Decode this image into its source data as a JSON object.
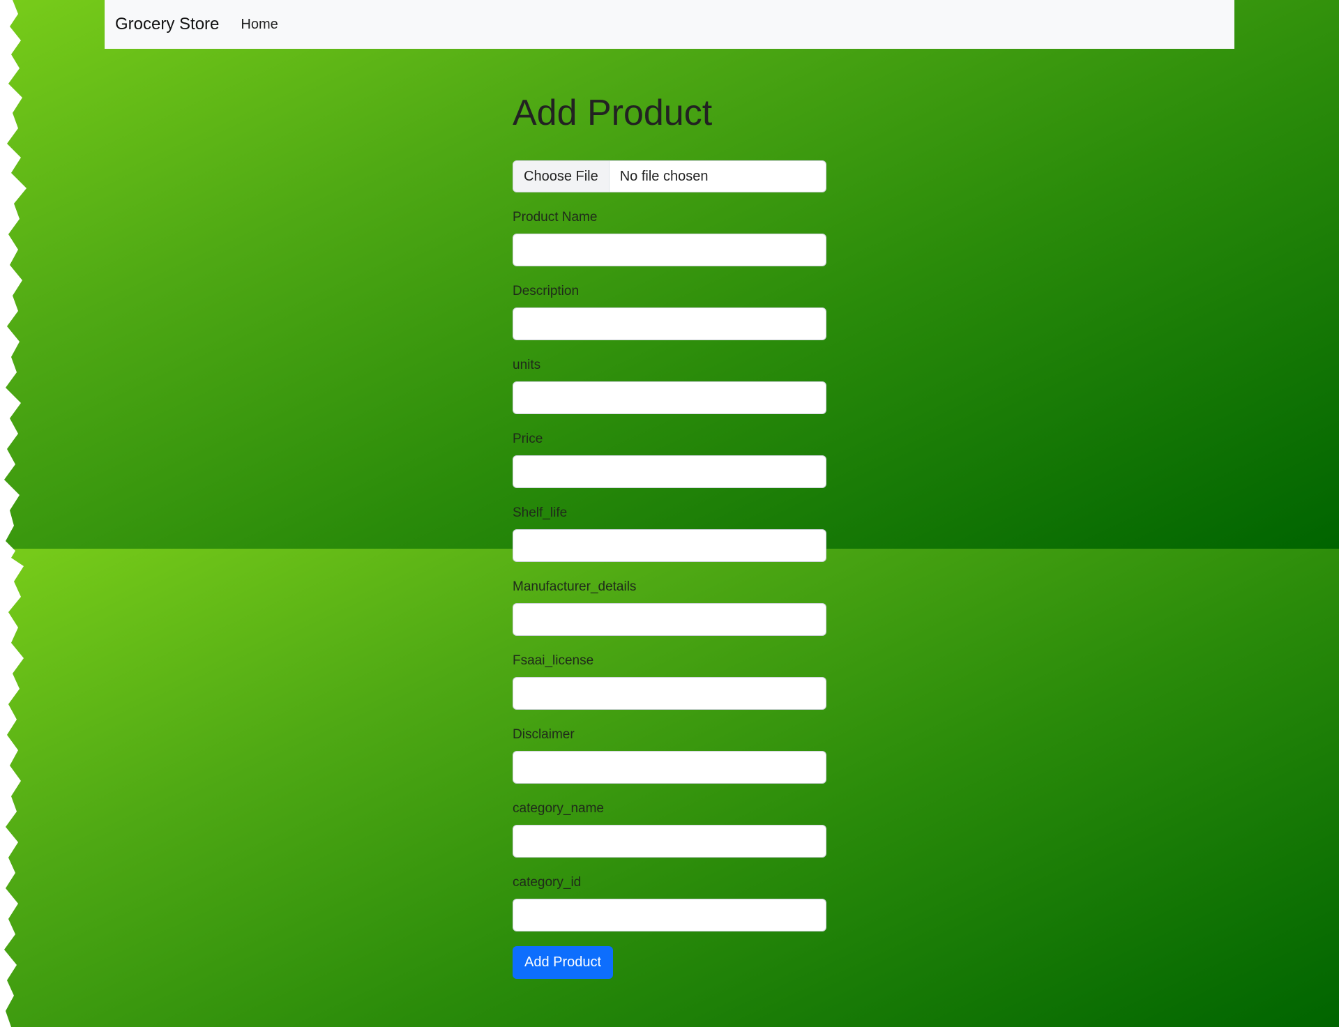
{
  "navbar": {
    "brand": "Grocery Store",
    "links": [
      "Home"
    ]
  },
  "page": {
    "title": "Add Product"
  },
  "file_upload": {
    "button_label": "Choose File",
    "status": "No file chosen"
  },
  "fields": [
    {
      "label": "Product Name",
      "value": ""
    },
    {
      "label": "Description",
      "value": ""
    },
    {
      "label": "units",
      "value": ""
    },
    {
      "label": "Price",
      "value": ""
    },
    {
      "label": "Shelf_life",
      "value": ""
    },
    {
      "label": "Manufacturer_details",
      "value": ""
    },
    {
      "label": "Fsaai_license",
      "value": ""
    },
    {
      "label": "Disclaimer",
      "value": ""
    },
    {
      "label": "category_name",
      "value": ""
    },
    {
      "label": "category_id",
      "value": ""
    }
  ],
  "submit": {
    "label": "Add Product",
    "color": "#0d6efd"
  },
  "theme": {
    "background_light": "#78cc1a",
    "background_dark": "#006400",
    "navbar_bg": "#f8f9fa"
  }
}
